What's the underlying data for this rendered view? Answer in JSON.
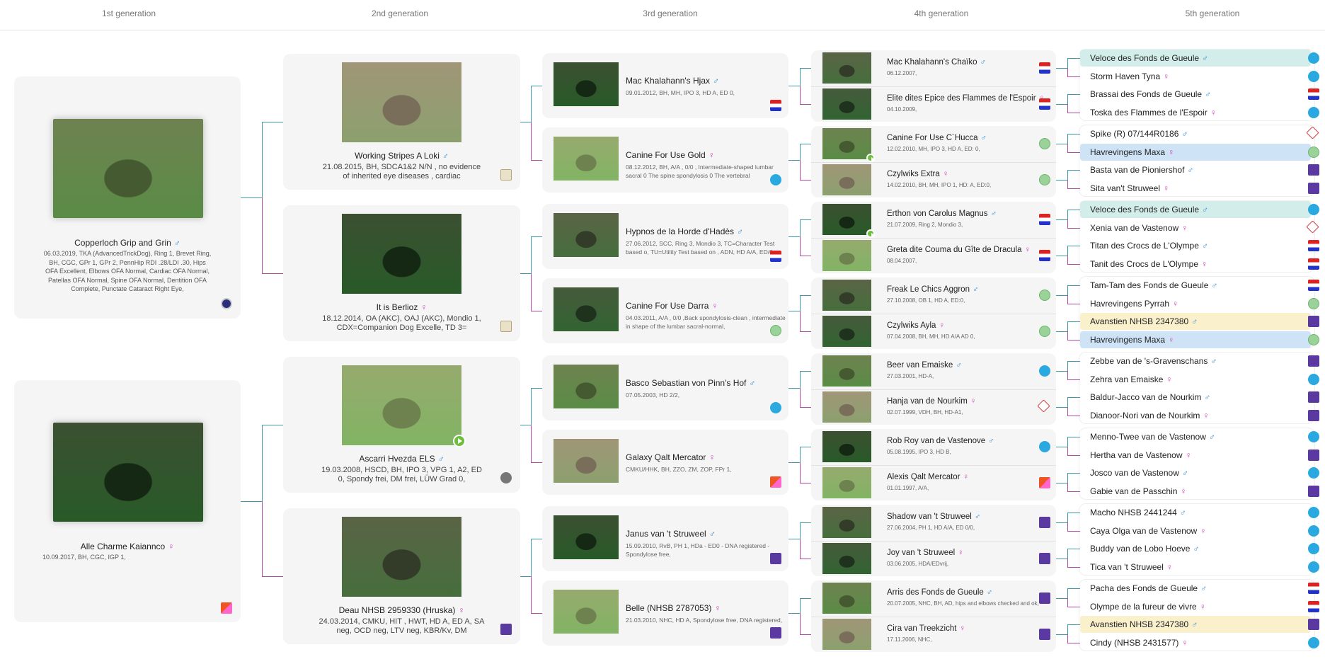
{
  "generations": [
    "1st generation",
    "2nd generation",
    "3rd generation",
    "4th generation",
    "5th generation"
  ],
  "sex": {
    "male": "♂",
    "female": "♀"
  },
  "colors": {
    "male": "#3a8ed0",
    "female": "#cc44bb",
    "highlight_teal": "#d3eeea",
    "highlight_blue": "#cfe3f7",
    "highlight_yellow": "#fbf0cc",
    "sire_line": "#3f9aa8",
    "dam_line": "#b34aa4"
  },
  "gen1": [
    {
      "name": "Copperloch Grip and Grin",
      "sex": "male",
      "info": "06.03.2019, TKA (AdvancedTrickDog), Ring 1, Brevet Ring, BH, CGC, GPr 1, GPr 2, PennHip RDI .28/LDI .30, Hips OFA Excellent, Elbows OFA Normal, Cardiac OFA Normal, Patellas OFA Normal, Spine OFA Normal, Dentition OFA Complete, Punctate Cataract Right Eye,",
      "badge": "navy",
      "photo": "brindle-dog-photo"
    },
    {
      "name": "Alle Charme Kaiannco",
      "sex": "female",
      "info": "10.09.2017, BH, CGC, IGP 1,",
      "badge": "orange",
      "photo": "brindle-dog-on-rock-photo"
    }
  ],
  "gen2": [
    {
      "name": "Working Stripes A Loki",
      "sex": "male",
      "info": "21.08.2015, BH, SDCA1&2 N/N , no evidence of inherited eye diseases , cardiac",
      "badge": "gold"
    },
    {
      "name": "It is Berlioz",
      "sex": "female",
      "info": "18.12.2014, OA (AKC), OAJ (AKC), Mondio 1, CDX=Companion Dog Excelle, TD 3=",
      "badge": "gold"
    },
    {
      "name": "Ascarri Hvezda ELS",
      "sex": "male",
      "info": "19.03.2008, HSCD, BH, IPO 3, VPG 1, A2, ED 0, Spondy frei, DM frei, LÜW Grad 0,",
      "badge": "gray",
      "video": true
    },
    {
      "name": "Deau NHSB 2959330 (Hruska)",
      "sex": "female",
      "info": "24.03.2014, CMKU, HIT , HWT, HD A, ED A, SA neg, OCD neg, LTV neg, KBR/Kv, DM",
      "badge": "purple"
    }
  ],
  "gen3": [
    {
      "name": "Mac Khalahann's Hjax",
      "sex": "male",
      "info": "09.01.2012, BH, MH, IPO 3, HD A, ED 0,",
      "badge": "flag"
    },
    {
      "name": "Canine For Use Gold",
      "sex": "female",
      "info": "08.12.2012, BH, A/A , 0/0 , Intermediate-shaped lumbar sacral 0 The spine spondylosis 0 The vertebral",
      "badge": "blue"
    },
    {
      "name": "Hypnos de la Horde d'Hadès",
      "sex": "male",
      "info": "27.06.2012, SCC, Ring 3, Mondio 3, TC=Character Test based o, TU=Utility Test based on , ADN, HD A/A, ED/0,",
      "badge": "flag"
    },
    {
      "name": "Canine For Use Darra",
      "sex": "female",
      "info": "04.03.2011, A/A , 0/0 ,Back spondylosis-clean , intermediate in shape of the lumbar sacral-normal,",
      "badge": "green"
    },
    {
      "name": "Basco Sebastian von Pinn's Hof",
      "sex": "male",
      "info": "07.05.2003, HD 2/2,",
      "badge": "blue"
    },
    {
      "name": "Galaxy Qalt Mercator",
      "sex": "female",
      "info": "CMKU/HHK, BH, ZZO, ZM, ZOP, FPr 1,",
      "badge": "orange"
    },
    {
      "name": "Janus van 't Struweel",
      "sex": "male",
      "info": "15.09.2010, RvB, PH 1, HDa - ED0 - DNA registered - Spondylose free,",
      "badge": "purple"
    },
    {
      "name": "Belle (NHSB 2787053)",
      "sex": "female",
      "info": "21.03.2010, NHC, HD A, Spondylose free, DNA registered,",
      "badge": "purple"
    }
  ],
  "gen4": [
    {
      "name": "Mac Khalahann's Chaïko",
      "sex": "male",
      "info": "06.12.2007,",
      "badge": "flag"
    },
    {
      "name": "Elite dites Epice des Flammes de l'Espoir",
      "sex": "female",
      "info": "04.10.2009,",
      "badge": "flag"
    },
    {
      "name": "Canine For Use C´Hucca",
      "sex": "male",
      "info": "12.02.2010, MH, IPO 3, HD A, ED: 0,",
      "badge": "green",
      "video": true
    },
    {
      "name": "Czylwiks Extra",
      "sex": "female",
      "info": "14.02.2010, BH, MH, IPO 1, HD: A, ED:0,",
      "badge": "green"
    },
    {
      "name": "Erthon von Carolus Magnus",
      "sex": "male",
      "info": "21.07.2009, Ring 2, Mondio 3,",
      "badge": "flag",
      "video": true
    },
    {
      "name": "Greta dite Couma du Gîte de Dracula",
      "sex": "female",
      "info": "08.04.2007,",
      "badge": "flag"
    },
    {
      "name": "Freak Le Chics Aggron",
      "sex": "male",
      "info": "27.10.2008, OB 1, HD A, ED:0,",
      "badge": "green"
    },
    {
      "name": "Czylwiks Ayla",
      "sex": "female",
      "info": "07.04.2008, BH, MH, HD A/A AD 0,",
      "badge": "green"
    },
    {
      "name": "Beer van Emaiske",
      "sex": "male",
      "info": "27.03.2001, HD-A,",
      "badge": "blue"
    },
    {
      "name": "Hanja van de Nourkim",
      "sex": "female",
      "info": "02.07.1999, VDH, BH, HD-A1,",
      "badge": "red"
    },
    {
      "name": "Rob Roy van de Vastenove",
      "sex": "male",
      "info": "05.08.1995, IPO 3, HD B,",
      "badge": "blue"
    },
    {
      "name": "Alexis Qalt Mercator",
      "sex": "female",
      "info": "01.01.1997, A/A,",
      "badge": "orange"
    },
    {
      "name": "Shadow van 't Struweel",
      "sex": "male",
      "info": "27.06.2004, PH 1, HD A/A, ED 0/0,",
      "badge": "purple"
    },
    {
      "name": "Joy van 't Struweel",
      "sex": "female",
      "info": "03.06.2005, HDA/EDvrij,",
      "badge": "purple"
    },
    {
      "name": "Arris des Fonds de Gueule",
      "sex": "male",
      "info": "20.07.2005, NHC, BH, AD, hips and elbows checked and ok,",
      "badge": "purple"
    },
    {
      "name": "Cira van Treekzicht",
      "sex": "female",
      "info": "17.11.2006, NHC,",
      "badge": "purple"
    }
  ],
  "gen5": [
    {
      "name": "Veloce des Fonds de Gueule",
      "sex": "male",
      "badge": "blue",
      "hl": "teal"
    },
    {
      "name": "Storm Haven Tyna",
      "sex": "female",
      "badge": "blue"
    },
    {
      "name": "Brassai des Fonds de Gueule",
      "sex": "male",
      "badge": "flag"
    },
    {
      "name": "Toska des Flammes de l'Espoir",
      "sex": "female",
      "badge": "blue"
    },
    {
      "name": "Spike (R) 07/144R0186",
      "sex": "male",
      "badge": "red"
    },
    {
      "name": "Havrevingens Maxa",
      "sex": "female",
      "badge": "green",
      "hl": "blue"
    },
    {
      "name": "Basta van de Pioniershof",
      "sex": "male",
      "badge": "purple"
    },
    {
      "name": "Sita van't Struweel",
      "sex": "female",
      "badge": "purple"
    },
    {
      "name": "Veloce des Fonds de Gueule",
      "sex": "male",
      "badge": "blue",
      "hl": "teal"
    },
    {
      "name": "Xenia van de Vastenow",
      "sex": "female",
      "badge": "red"
    },
    {
      "name": "Titan des Crocs de L'Olympe",
      "sex": "male",
      "badge": "flag"
    },
    {
      "name": "Tanit des Crocs de L'Olympe",
      "sex": "female",
      "badge": "flag"
    },
    {
      "name": "Tam-Tam des Fonds de Gueule",
      "sex": "male",
      "badge": "flag"
    },
    {
      "name": "Havrevingens Pyrrah",
      "sex": "female",
      "badge": "green"
    },
    {
      "name": "Avanstien NHSB 2347380",
      "sex": "male",
      "badge": "purple",
      "hl": "yellow"
    },
    {
      "name": "Havrevingens Maxa",
      "sex": "female",
      "badge": "green",
      "hl": "blue"
    },
    {
      "name": "Zebbe van de 's-Gravenschans",
      "sex": "male",
      "badge": "purple"
    },
    {
      "name": "Zehra van Emaiske",
      "sex": "female",
      "badge": "blue"
    },
    {
      "name": "Baldur-Jacco van de Nourkim",
      "sex": "male",
      "badge": "purple"
    },
    {
      "name": "Dianoor-Nori van de Nourkim",
      "sex": "female",
      "badge": "purple"
    },
    {
      "name": "Menno-Twee van de Vastenow",
      "sex": "male",
      "badge": "blue"
    },
    {
      "name": "Hertha van de Vastenow",
      "sex": "female",
      "badge": "purple"
    },
    {
      "name": "Josco van de Vastenow",
      "sex": "male",
      "badge": "blue"
    },
    {
      "name": "Gabie van de Passchin",
      "sex": "female",
      "badge": "purple"
    },
    {
      "name": "Macho NHSB 2441244",
      "sex": "male",
      "badge": "blue"
    },
    {
      "name": "Caya Olga van de Vastenow",
      "sex": "female",
      "badge": "blue"
    },
    {
      "name": "Buddy van de Lobo Hoeve",
      "sex": "male",
      "badge": "blue"
    },
    {
      "name": "Tica van 't Struweel",
      "sex": "female",
      "badge": "blue"
    },
    {
      "name": "Pacha des Fonds de Gueule",
      "sex": "male",
      "badge": "flag"
    },
    {
      "name": "Olympe de la fureur de vivre",
      "sex": "female",
      "badge": "flag"
    },
    {
      "name": "Avanstien NHSB 2347380",
      "sex": "male",
      "badge": "purple",
      "hl": "yellow"
    },
    {
      "name": "Cindy (NHSB 2431577)",
      "sex": "female",
      "badge": "blue"
    }
  ]
}
